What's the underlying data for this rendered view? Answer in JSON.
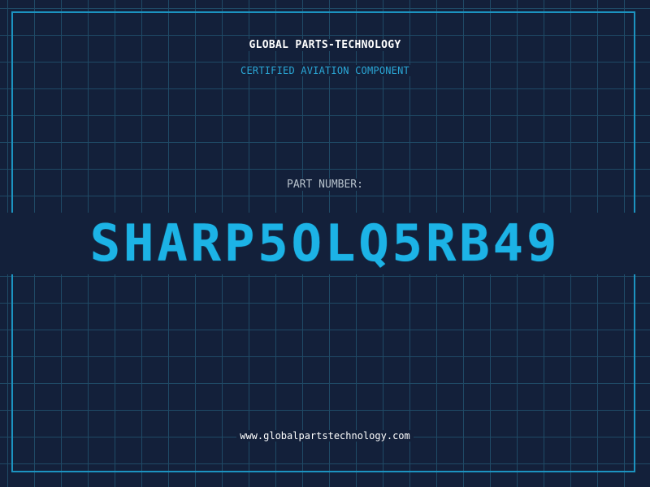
{
  "header": {
    "company": "GLOBAL PARTS-TECHNOLOGY",
    "tagline": "CERTIFIED AVIATION COMPONENT"
  },
  "part": {
    "label": "PART NUMBER:",
    "number": "SHARP5OLQ5RB49"
  },
  "footer": {
    "website": "www.globalpartstechnology.com"
  },
  "colors": {
    "background": "#13203a",
    "grid": "#1f4a66",
    "frame": "#1c93c0",
    "accent": "#1cb3e6"
  }
}
